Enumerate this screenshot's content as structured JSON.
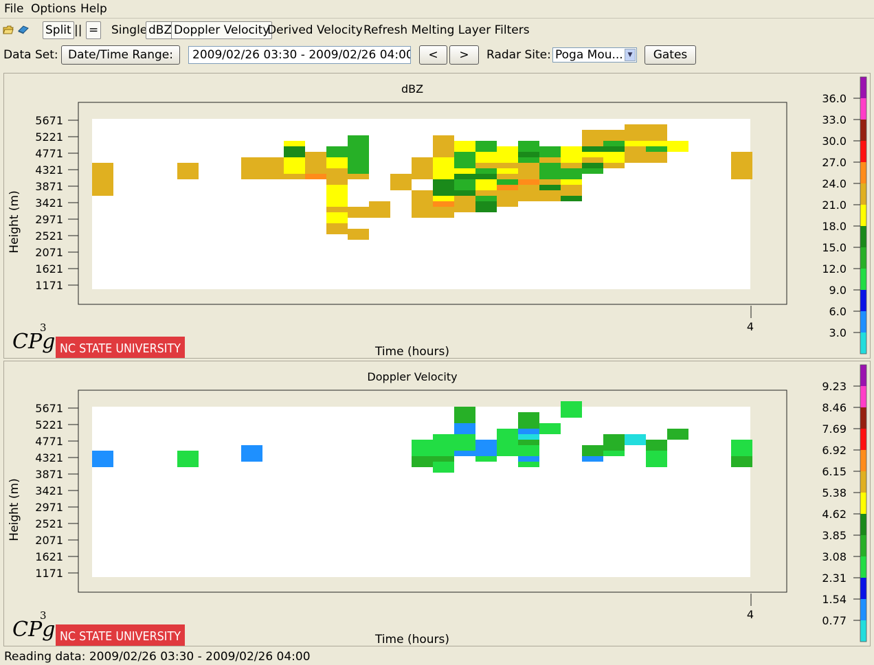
{
  "menus": [
    "File",
    "Options",
    "Help"
  ],
  "toolbar": {
    "open_icon": "open-folder-icon",
    "book_icon": "book-icon",
    "split": "Split",
    "parallel": "||",
    "equal": "=",
    "single": "Single",
    "dbz": "dBZ",
    "doppler": "Doppler Velocity",
    "derived": "Derived Velocity",
    "refresh": "Refresh Melting Layer Filters"
  },
  "dataset": {
    "label": "Data Set:",
    "range_button": "Date/Time Range:",
    "range_value": "2009/02/26 03:30 - 2009/02/26 04:00",
    "prev": "<",
    "next": ">",
    "site_label": "Radar Site:",
    "site_value": "Poga Mou...",
    "gates": "Gates"
  },
  "logo": {
    "cpg": "CPg",
    "cpg_sup": "3",
    "ncsu": "NC STATE UNIVERSITY",
    "ncsu_color": "#e03a3e"
  },
  "status": "Reading data: 2009/02/26 03:30 - 2009/02/26 04:00",
  "chart_data": [
    {
      "type": "heatmap",
      "title": "dBZ",
      "xlabel": "Time (hours)",
      "ylabel": "Height (m)",
      "x_ticks": [
        "4"
      ],
      "y_ticks": [
        "5671",
        "5221",
        "4771",
        "4321",
        "3871",
        "3421",
        "2971",
        "2521",
        "2071",
        "1621",
        "1171"
      ],
      "colorbar_ticks": [
        "36.0",
        "33.0",
        "30.0",
        "27.0",
        "24.0",
        "21.0",
        "18.0",
        "15.0",
        "12.0",
        "9.0",
        "6.0",
        "3.0"
      ],
      "colorbar_colors": [
        "#9b12b0",
        "#ff3ec8",
        "#962010",
        "#ff1010",
        "#ff8c1a",
        "#e0b020",
        "#ffff00",
        "#1a8a1a",
        "#27b027",
        "#22dd44",
        "#0a14e6",
        "#1e90ff",
        "#22dddd"
      ],
      "cells": [
        [
          0,
          20,
          3,
          22
        ],
        [
          0,
          17,
          3,
          23
        ],
        [
          4,
          20,
          3,
          22
        ],
        [
          7,
          20,
          2,
          22
        ],
        [
          7,
          21,
          3,
          22
        ],
        [
          8,
          20,
          4,
          22
        ],
        [
          9,
          20,
          5,
          22
        ],
        [
          9,
          21,
          6,
          21
        ],
        [
          9,
          22,
          5,
          19
        ],
        [
          9,
          24,
          2,
          16
        ],
        [
          10,
          20,
          3,
          25
        ],
        [
          10,
          21,
          3,
          24
        ],
        [
          10,
          22,
          2,
          23
        ],
        [
          10,
          23,
          2,
          23
        ],
        [
          11,
          10,
          2,
          22
        ],
        [
          11,
          12,
          2,
          20
        ],
        [
          11,
          14,
          4,
          22
        ],
        [
          11,
          15,
          4,
          19
        ],
        [
          11,
          17,
          3,
          20
        ],
        [
          11,
          19,
          4,
          22
        ],
        [
          11,
          22,
          2,
          19
        ],
        [
          11,
          24,
          2,
          15
        ],
        [
          12,
          9,
          2,
          22
        ],
        [
          12,
          13,
          2,
          22
        ],
        [
          12,
          20,
          2,
          22
        ],
        [
          12,
          21,
          2,
          14
        ],
        [
          12,
          22,
          2,
          14
        ],
        [
          12,
          23,
          2,
          14
        ],
        [
          12,
          24,
          4,
          15
        ],
        [
          13,
          13,
          2,
          22
        ],
        [
          13,
          14,
          2,
          22
        ],
        [
          14,
          18,
          3,
          22
        ],
        [
          15,
          13,
          2,
          22
        ],
        [
          15,
          15,
          2,
          22
        ],
        [
          15,
          16,
          2,
          22
        ],
        [
          15,
          20,
          2,
          22
        ],
        [
          15,
          22,
          2,
          22
        ],
        [
          16,
          13,
          2,
          22
        ],
        [
          16,
          14,
          2,
          23
        ],
        [
          16,
          15,
          2,
          25
        ],
        [
          16,
          16,
          2,
          20
        ],
        [
          16,
          17,
          2,
          18
        ],
        [
          16,
          19,
          3,
          18
        ],
        [
          16,
          20,
          2,
          21
        ],
        [
          16,
          21,
          3,
          19
        ],
        [
          16,
          22,
          2,
          20
        ],
        [
          16,
          24,
          4,
          22
        ],
        [
          17,
          14,
          2,
          23
        ],
        [
          17,
          15,
          2,
          23
        ],
        [
          17,
          16,
          2,
          24
        ],
        [
          17,
          17,
          2,
          16
        ],
        [
          17,
          18,
          2,
          14
        ],
        [
          17,
          19,
          2,
          14
        ],
        [
          17,
          20,
          2,
          16
        ],
        [
          17,
          21,
          3,
          19
        ],
        [
          17,
          22,
          2,
          15
        ],
        [
          17,
          23,
          2,
          14
        ],
        [
          17,
          24,
          2,
          14
        ],
        [
          17,
          25,
          2,
          20
        ],
        [
          18,
          14,
          2,
          16
        ],
        [
          18,
          15,
          2,
          16
        ],
        [
          18,
          16,
          2,
          15
        ],
        [
          18,
          17,
          2,
          23
        ],
        [
          18,
          18,
          3,
          20
        ],
        [
          18,
          19,
          2,
          21
        ],
        [
          18,
          20,
          3,
          18
        ],
        [
          18,
          21,
          2,
          14
        ],
        [
          18,
          22,
          2,
          24
        ],
        [
          18,
          23,
          2,
          20
        ],
        [
          18,
          24,
          2,
          20
        ],
        [
          18,
          25,
          2,
          15
        ],
        [
          19,
          15,
          3,
          22
        ],
        [
          19,
          16,
          3,
          22
        ],
        [
          19,
          17,
          2,
          23
        ],
        [
          19,
          18,
          2,
          25
        ],
        [
          19,
          19,
          3,
          14
        ],
        [
          19,
          20,
          2,
          22
        ],
        [
          19,
          21,
          3,
          19
        ],
        [
          19,
          22,
          2,
          23
        ],
        [
          19,
          23,
          3,
          20
        ],
        [
          20,
          16,
          3,
          22
        ],
        [
          20,
          17,
          3,
          22
        ],
        [
          20,
          18,
          3,
          22
        ],
        [
          20,
          19,
          2,
          25
        ],
        [
          20,
          20,
          2,
          22
        ],
        [
          20,
          21,
          2,
          22
        ],
        [
          20,
          22,
          2,
          23
        ],
        [
          20,
          23,
          2,
          14
        ],
        [
          20,
          24,
          3,
          16
        ],
        [
          20,
          25,
          2,
          15
        ],
        [
          21,
          16,
          2,
          22
        ],
        [
          21,
          17,
          2,
          23
        ],
        [
          21,
          18,
          3,
          18
        ],
        [
          21,
          19,
          2,
          22
        ],
        [
          21,
          20,
          2,
          15
        ],
        [
          21,
          21,
          2,
          14
        ],
        [
          21,
          22,
          2,
          14
        ],
        [
          21,
          23,
          2,
          22
        ],
        [
          21,
          24,
          2,
          14
        ],
        [
          22,
          16,
          2,
          16
        ],
        [
          22,
          17,
          2,
          22
        ],
        [
          22,
          18,
          3,
          22
        ],
        [
          22,
          19,
          2,
          21
        ],
        [
          22,
          20,
          3,
          15
        ],
        [
          22,
          21,
          3,
          14
        ],
        [
          22,
          22,
          2,
          22
        ],
        [
          22,
          23,
          2,
          21
        ],
        [
          22,
          24,
          2,
          21
        ],
        [
          23,
          21,
          2,
          14
        ],
        [
          23,
          22,
          3,
          16
        ],
        [
          23,
          23,
          2,
          24
        ],
        [
          23,
          24,
          2,
          20
        ],
        [
          23,
          25,
          2,
          16
        ],
        [
          23,
          26,
          2,
          22
        ],
        [
          23,
          27,
          2,
          22
        ],
        [
          24,
          22,
          3,
          22
        ],
        [
          24,
          23,
          3,
          21
        ],
        [
          24,
          24,
          2,
          21
        ],
        [
          24,
          25,
          2,
          16
        ],
        [
          24,
          26,
          3,
          13
        ],
        [
          24,
          27,
          2,
          22
        ],
        [
          25,
          23,
          3,
          24
        ],
        [
          25,
          24,
          3,
          23
        ],
        [
          25,
          25,
          2,
          22
        ],
        [
          25,
          26,
          2,
          21
        ],
        [
          25,
          27,
          2,
          22
        ],
        [
          25,
          28,
          2,
          22
        ],
        [
          26,
          23,
          3,
          22
        ],
        [
          26,
          24,
          2,
          24
        ],
        [
          26,
          25,
          2,
          15
        ],
        [
          26,
          26,
          2,
          21
        ],
        [
          26,
          27,
          2,
          22
        ],
        [
          26,
          28,
          2,
          22
        ],
        [
          27,
          25,
          2,
          20
        ],
        [
          30,
          20,
          3,
          22
        ],
        [
          30,
          22,
          3,
          22
        ]
      ]
    },
    {
      "type": "heatmap",
      "title": "Doppler Velocity",
      "xlabel": "Time (hours)",
      "ylabel": "Height (m)",
      "x_ticks": [
        "4"
      ],
      "y_ticks": [
        "5671",
        "5221",
        "4771",
        "4321",
        "3871",
        "3421",
        "2971",
        "2521",
        "2071",
        "1621",
        "1171"
      ],
      "colorbar_ticks": [
        "9.23",
        "8.46",
        "7.69",
        "6.92",
        "6.15",
        "5.38",
        "4.62",
        "3.85",
        "3.08",
        "2.31",
        "1.54",
        "0.77"
      ],
      "colorbar_colors": [
        "#9b12b0",
        "#ff3ec8",
        "#962010",
        "#ff1010",
        "#ff8c1a",
        "#e0b020",
        "#ffff00",
        "#1a8a1a",
        "#27b027",
        "#22dd44",
        "#0a14e6",
        "#1e90ff",
        "#22dddd"
      ],
      "cells": [
        [
          0,
          20,
          3,
          1.2
        ],
        [
          4,
          20,
          3,
          2.5
        ],
        [
          7,
          21,
          3,
          1.2
        ],
        [
          15,
          20,
          3,
          3.5
        ],
        [
          15,
          22,
          3,
          2.5
        ],
        [
          16,
          19,
          2,
          2.5
        ],
        [
          16,
          20,
          3,
          2.5
        ],
        [
          16,
          21,
          3,
          3.5
        ],
        [
          16,
          22,
          2,
          2.5
        ],
        [
          16,
          23,
          2,
          2.5
        ],
        [
          16,
          24,
          2,
          2.5
        ],
        [
          17,
          22,
          2,
          1.2
        ],
        [
          17,
          23,
          2,
          2.5
        ],
        [
          17,
          24,
          2,
          2.5
        ],
        [
          17,
          25,
          2,
          2.5
        ],
        [
          17,
          26,
          2,
          1.2
        ],
        [
          17,
          27,
          2,
          1.2
        ],
        [
          17,
          28,
          2,
          3.5
        ],
        [
          17,
          29,
          2,
          3.5
        ],
        [
          18,
          21,
          2,
          2.5
        ],
        [
          18,
          22,
          2,
          1.2
        ],
        [
          18,
          23,
          2,
          1.2
        ],
        [
          19,
          22,
          2,
          2.5
        ],
        [
          19,
          23,
          3,
          2.5
        ],
        [
          19,
          24,
          3,
          2.5
        ],
        [
          19,
          25,
          2,
          2.5
        ],
        [
          20,
          20,
          2,
          2.5
        ],
        [
          20,
          21,
          2,
          1.2
        ],
        [
          20,
          22,
          2,
          2.5
        ],
        [
          20,
          23,
          2,
          2.5
        ],
        [
          20,
          24,
          2,
          3.5
        ],
        [
          20,
          25,
          3,
          0.4
        ],
        [
          20,
          26,
          2,
          1.2
        ],
        [
          20,
          27,
          2,
          3.5
        ],
        [
          20,
          28,
          2,
          3.5
        ],
        [
          21,
          26,
          2,
          2.5
        ],
        [
          22,
          29,
          2,
          2.5
        ],
        [
          22,
          30,
          2,
          2.5
        ],
        [
          23,
          21,
          2,
          1.2
        ],
        [
          23,
          22,
          2,
          3.5
        ],
        [
          24,
          22,
          2,
          2.5
        ],
        [
          24,
          23,
          3,
          3.5
        ],
        [
          25,
          24,
          2,
          0.4
        ],
        [
          26,
          20,
          2,
          2.5
        ],
        [
          26,
          22,
          2,
          2.5
        ],
        [
          26,
          23,
          2,
          3.5
        ],
        [
          27,
          25,
          2,
          3.5
        ],
        [
          30,
          20,
          3,
          3.5
        ],
        [
          30,
          22,
          3,
          2.5
        ]
      ]
    }
  ]
}
